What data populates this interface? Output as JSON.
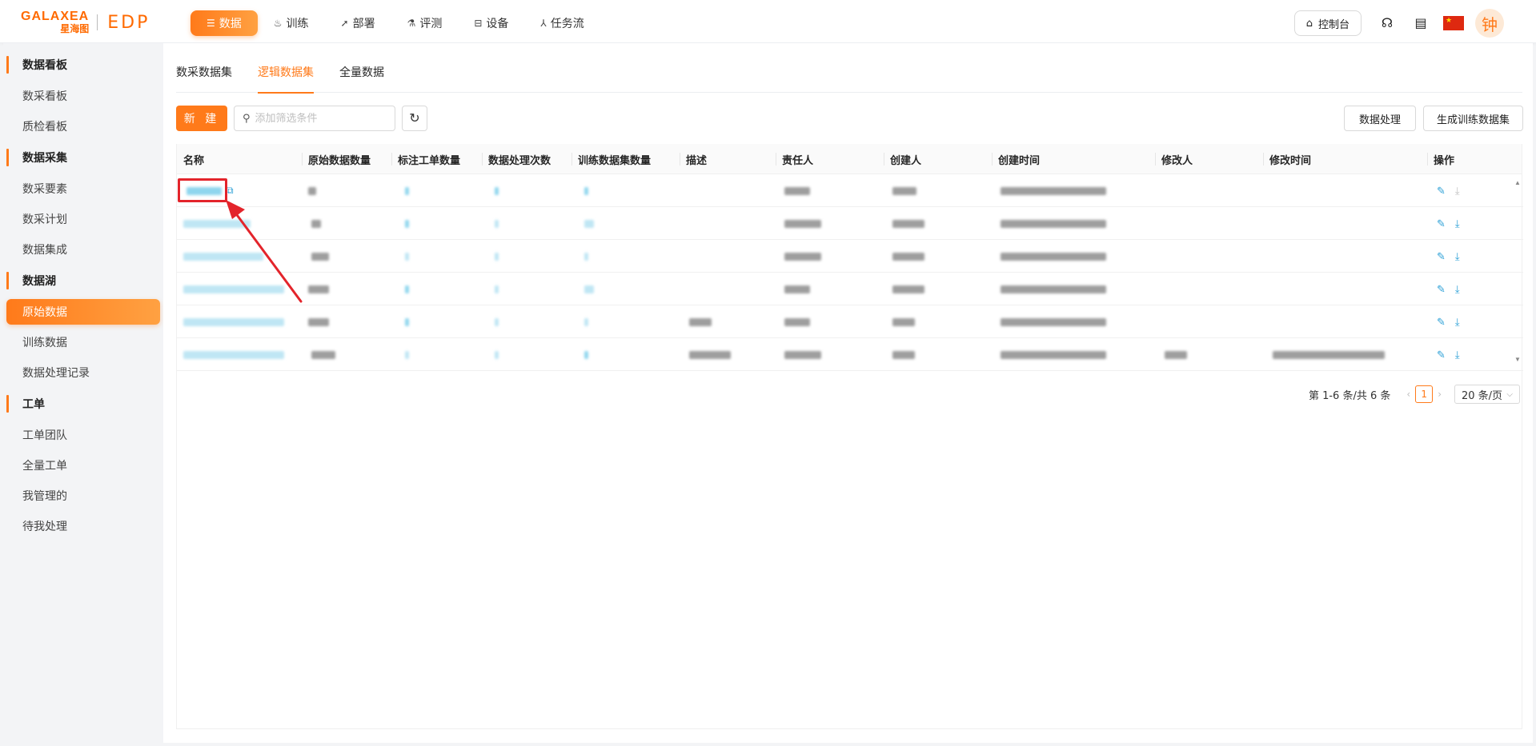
{
  "header": {
    "logo_en": "GALAXEA",
    "logo_cn": "星海图",
    "logo_product": "EDP",
    "nav": [
      {
        "label": "数据",
        "icon": "database-icon",
        "active": true
      },
      {
        "label": "训练",
        "icon": "flame-icon",
        "active": false
      },
      {
        "label": "部署",
        "icon": "rocket-icon",
        "active": false
      },
      {
        "label": "评测",
        "icon": "flask-icon",
        "active": false
      },
      {
        "label": "设备",
        "icon": "robot-icon",
        "active": false
      },
      {
        "label": "任务流",
        "icon": "workflow-icon",
        "active": false
      }
    ],
    "console_label": "控制台",
    "avatar_text": "钟"
  },
  "sidebar": {
    "groups": [
      {
        "title": "数据看板",
        "items": [
          "数采看板",
          "质检看板"
        ]
      },
      {
        "title": "数据采集",
        "items": [
          "数采要素",
          "数采计划",
          "数据集成"
        ]
      },
      {
        "title": "数据湖",
        "items": [
          "原始数据",
          "训练数据",
          "数据处理记录"
        ]
      },
      {
        "title": "工单",
        "items": [
          "工单团队",
          "全量工单",
          "我管理的",
          "待我处理"
        ]
      }
    ],
    "active_item": "原始数据"
  },
  "tabs": [
    {
      "label": "数采数据集",
      "active": false
    },
    {
      "label": "逻辑数据集",
      "active": true
    },
    {
      "label": "全量数据",
      "active": false
    }
  ],
  "toolbar": {
    "new_label": "新 建",
    "search_placeholder": "添加筛选条件",
    "process_label": "数据处理",
    "generate_label": "生成训练数据集"
  },
  "table": {
    "columns": [
      "名称",
      "原始数据数量",
      "标注工单数量",
      "数据处理次数",
      "训练数据集数量",
      "描述",
      "责任人",
      "创建人",
      "创建时间",
      "修改人",
      "修改时间",
      "操作"
    ],
    "row_count": 6
  },
  "pagination": {
    "total_text": "第 1-6 条/共 6 条",
    "current_page": "1",
    "page_size": "20 条/页"
  },
  "colors": {
    "accent": "#ff7a1a",
    "link": "#2a9fd6",
    "annotation": "#e3242b"
  }
}
